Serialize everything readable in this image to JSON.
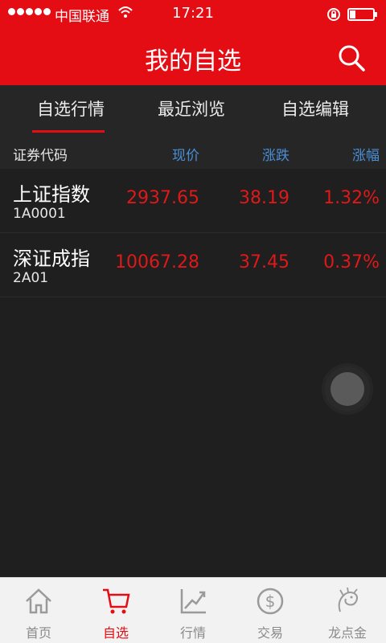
{
  "status": {
    "carrier": "中国联通",
    "time": "17:21"
  },
  "header": {
    "title": "我的自选"
  },
  "tabs": [
    {
      "label": "自选行情",
      "active": true
    },
    {
      "label": "最近浏览",
      "active": false
    },
    {
      "label": "自选编辑",
      "active": false
    }
  ],
  "columns": {
    "code": "证券代码",
    "price": "现价",
    "change": "涨跌",
    "pct": "涨幅"
  },
  "rows": [
    {
      "name": "上证指数",
      "code": "1A0001",
      "price": "2937.65",
      "change": "38.19",
      "pct": "1.32%"
    },
    {
      "name": "深证成指",
      "code": "2A01",
      "price": "10067.28",
      "change": "37.45",
      "pct": "0.37%"
    }
  ],
  "nav": [
    {
      "label": "首页",
      "icon": "home-icon",
      "active": false
    },
    {
      "label": "自选",
      "icon": "cart-icon",
      "active": true
    },
    {
      "label": "行情",
      "icon": "chart-icon",
      "active": false
    },
    {
      "label": "交易",
      "icon": "dollar-icon",
      "active": false
    },
    {
      "label": "龙点金",
      "icon": "dragon-icon",
      "active": false
    }
  ],
  "colors": {
    "brand_red": "#e50d14",
    "price_red": "#e01818",
    "header_blue": "#4a8fd8",
    "background": "#1f1f1f"
  }
}
